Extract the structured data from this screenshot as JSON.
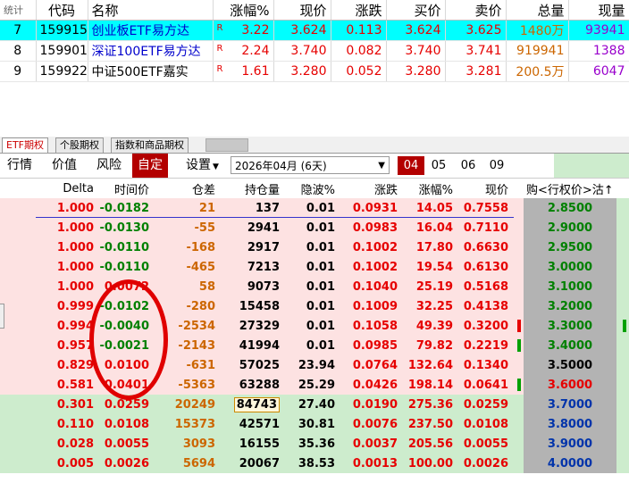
{
  "etf_table": {
    "headers": [
      "统计",
      "代码",
      "名称",
      "涨幅%",
      "现价",
      "涨跌",
      "买价",
      "卖价",
      "总量",
      "现量"
    ],
    "rows": [
      {
        "idx": "7",
        "code": "159915",
        "name": "创业板ETF易方达",
        "tag": "R",
        "chg_pct": "3.22",
        "price": "3.624",
        "chg": "0.113",
        "bid": "3.624",
        "ask": "3.625",
        "volume": "1480万",
        "cur_vol": "93941"
      },
      {
        "idx": "8",
        "code": "159901",
        "name": "深证100ETF易方达",
        "tag": "R",
        "chg_pct": "2.24",
        "price": "3.740",
        "chg": "0.082",
        "bid": "3.740",
        "ask": "3.741",
        "volume": "919941",
        "cur_vol": "1388"
      },
      {
        "idx": "9",
        "code": "159922",
        "name": "中证500ETF嘉实",
        "tag": "R",
        "chg_pct": "1.61",
        "price": "3.280",
        "chg": "0.052",
        "bid": "3.280",
        "ask": "3.281",
        "volume": "200.5万",
        "cur_vol": "6047"
      }
    ]
  },
  "tabs": [
    "ETF期权",
    "个股期权",
    "指数和商品期权"
  ],
  "toolbar": {
    "items": [
      "行情",
      "价值",
      "风险",
      "自定",
      "设置"
    ],
    "settings_arrow": "▼",
    "month_value": "2026年04月 (6天)",
    "months": [
      "04",
      "05",
      "06",
      "09"
    ]
  },
  "options_table": {
    "headers": [
      "Delta",
      "时间价",
      "仓差",
      "持仓量",
      "隐波%",
      "涨跌",
      "涨幅%",
      "现价",
      "购<行权价>沽↑"
    ],
    "rows": [
      {
        "delta": "1.000",
        "time_value": "-0.0182",
        "oi_change": "21",
        "oi": "137",
        "iv": "0.01",
        "chg": "0.0931",
        "chg_pct": "14.05",
        "price": "0.7558",
        "strike": "2.8500",
        "zone": "itm"
      },
      {
        "delta": "1.000",
        "time_value": "-0.0130",
        "oi_change": "-55",
        "oi": "2941",
        "iv": "0.01",
        "chg": "0.0983",
        "chg_pct": "16.04",
        "price": "0.7110",
        "strike": "2.9000",
        "zone": "itm"
      },
      {
        "delta": "1.000",
        "time_value": "-0.0110",
        "oi_change": "-168",
        "oi": "2917",
        "iv": "0.01",
        "chg": "0.1002",
        "chg_pct": "17.80",
        "price": "0.6630",
        "strike": "2.9500",
        "zone": "itm"
      },
      {
        "delta": "1.000",
        "time_value": "-0.0110",
        "oi_change": "-465",
        "oi": "7213",
        "iv": "0.01",
        "chg": "0.1002",
        "chg_pct": "19.54",
        "price": "0.6130",
        "strike": "3.0000",
        "zone": "itm"
      },
      {
        "delta": "1.000",
        "time_value": "0.0072",
        "oi_change": "58",
        "oi": "9073",
        "iv": "0.01",
        "chg": "0.1040",
        "chg_pct": "25.19",
        "price": "0.5168",
        "strike": "3.1000",
        "zone": "itm"
      },
      {
        "delta": "0.999",
        "time_value": "-0.0102",
        "oi_change": "-280",
        "oi": "15458",
        "iv": "0.01",
        "chg": "0.1009",
        "chg_pct": "32.25",
        "price": "0.4138",
        "strike": "3.2000",
        "zone": "itm"
      },
      {
        "delta": "0.994",
        "time_value": "-0.0040",
        "oi_change": "-2534",
        "oi": "27329",
        "iv": "0.01",
        "chg": "0.1058",
        "chg_pct": "49.39",
        "price": "0.3200",
        "strike": "3.3000",
        "zone": "itm",
        "mark": "red",
        "right_mark": "green"
      },
      {
        "delta": "0.957",
        "time_value": "-0.0021",
        "oi_change": "-2143",
        "oi": "41994",
        "iv": "0.01",
        "chg": "0.0985",
        "chg_pct": "79.82",
        "price": "0.2219",
        "strike": "3.4000",
        "zone": "itm",
        "mark": "green"
      },
      {
        "delta": "0.829",
        "time_value": "0.0100",
        "oi_change": "-631",
        "oi": "57025",
        "iv": "23.94",
        "chg": "0.0764",
        "chg_pct": "132.64",
        "price": "0.1340",
        "strike": "3.5000",
        "zone": "itm"
      },
      {
        "delta": "0.581",
        "time_value": "0.0401",
        "oi_change": "-5363",
        "oi": "63288",
        "iv": "25.29",
        "chg": "0.0426",
        "chg_pct": "198.14",
        "price": "0.0641",
        "strike": "3.6000",
        "zone": "itm",
        "mark": "green",
        "strike_red": true
      },
      {
        "delta": "0.301",
        "time_value": "0.0259",
        "oi_change": "20249",
        "oi": "84743",
        "iv": "27.40",
        "chg": "0.0190",
        "chg_pct": "275.36",
        "price": "0.0259",
        "strike": "3.7000",
        "zone": "otm",
        "oi_boxed": true
      },
      {
        "delta": "0.110",
        "time_value": "0.0108",
        "oi_change": "15373",
        "oi": "42571",
        "iv": "30.81",
        "chg": "0.0076",
        "chg_pct": "237.50",
        "price": "0.0108",
        "strike": "3.8000",
        "zone": "otm"
      },
      {
        "delta": "0.028",
        "time_value": "0.0055",
        "oi_change": "3093",
        "oi": "16155",
        "iv": "35.36",
        "chg": "0.0037",
        "chg_pct": "205.56",
        "price": "0.0055",
        "strike": "3.9000",
        "zone": "otm"
      },
      {
        "delta": "0.005",
        "time_value": "0.0026",
        "oi_change": "5694",
        "oi": "20067",
        "iv": "38.53",
        "chg": "0.0013",
        "chg_pct": "100.00",
        "price": "0.0026",
        "strike": "4.0000",
        "zone": "otm"
      }
    ]
  },
  "colors": {
    "selected_row": "#00ffff",
    "up_red": "#e60000",
    "down_green": "#008000",
    "active_button": "#b30000",
    "itm_bg": "#fde2e2",
    "otm_bg": "#cdeccd",
    "strike_bg": "#b3b3b3",
    "annotation_circle": "#e00000"
  }
}
